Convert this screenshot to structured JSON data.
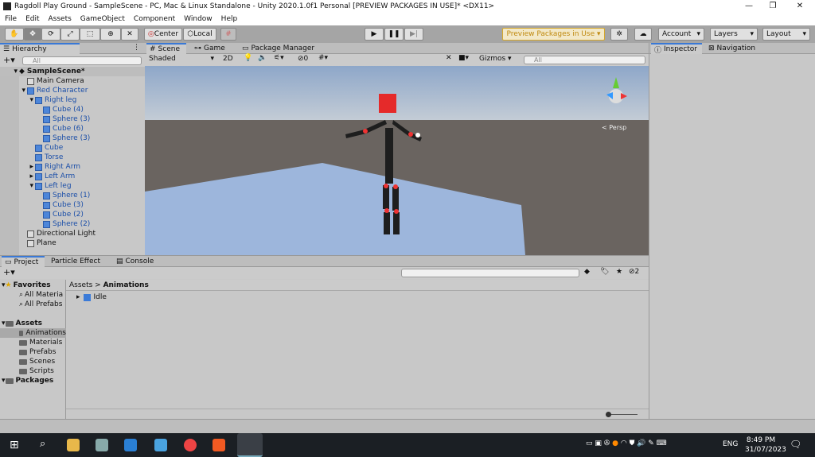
{
  "window": {
    "title": "Ragdoll Play Ground - SampleScene - PC, Mac & Linux Standalone - Unity 2020.1.0f1 Personal [PREVIEW PACKAGES IN USE]* <DX11>",
    "min": "—",
    "max": "❐",
    "close": "✕"
  },
  "menu": [
    "File",
    "Edit",
    "Assets",
    "GameObject",
    "Component",
    "Window",
    "Help"
  ],
  "toolbar": {
    "center": "Center",
    "local": "Local",
    "preview": "Preview Packages in Use ▾",
    "account": "Account",
    "layers": "Layers",
    "layout": "Layout"
  },
  "hierarchy": {
    "title": "Hierarchy",
    "search": "All",
    "items": [
      {
        "label": "SampleScene*",
        "level": 0,
        "arrow": "▾",
        "bold": true
      },
      {
        "label": "Main Camera",
        "level": 1,
        "arrow": ""
      },
      {
        "label": "Red Character",
        "level": 1,
        "arrow": "▾",
        "blue": true
      },
      {
        "label": "Right leg",
        "level": 2,
        "arrow": "▾",
        "blue": true
      },
      {
        "label": "Cube (4)",
        "level": 3,
        "arrow": "",
        "blue": true
      },
      {
        "label": "Sphere (3)",
        "level": 3,
        "arrow": "",
        "blue": true
      },
      {
        "label": "Cube (6)",
        "level": 3,
        "arrow": "",
        "blue": true
      },
      {
        "label": "Sphere (3)",
        "level": 3,
        "arrow": "",
        "blue": true
      },
      {
        "label": "Cube",
        "level": 2,
        "arrow": "",
        "blue": true
      },
      {
        "label": "Torse",
        "level": 2,
        "arrow": "",
        "blue": true
      },
      {
        "label": "Right Arm",
        "level": 2,
        "arrow": "▸",
        "blue": true
      },
      {
        "label": "Left Arm",
        "level": 2,
        "arrow": "▸",
        "blue": true
      },
      {
        "label": "Left leg",
        "level": 2,
        "arrow": "▾",
        "blue": true
      },
      {
        "label": "Sphere (1)",
        "level": 3,
        "arrow": "",
        "blue": true
      },
      {
        "label": "Cube (3)",
        "level": 3,
        "arrow": "",
        "blue": true
      },
      {
        "label": "Cube (2)",
        "level": 3,
        "arrow": "",
        "blue": true
      },
      {
        "label": "Sphere (2)",
        "level": 3,
        "arrow": "",
        "blue": true
      },
      {
        "label": "Directional Light",
        "level": 1,
        "arrow": ""
      },
      {
        "label": "Plane",
        "level": 1,
        "arrow": ""
      }
    ]
  },
  "scene": {
    "tabs": [
      "Scene",
      "Game",
      "Package Manager"
    ],
    "shading": "Shaded",
    "mode2d": "2D",
    "hidden_count": "0",
    "gizmos": "Gizmos",
    "search": "All",
    "persp": "< Persp"
  },
  "inspector": {
    "tabs": [
      "Inspector",
      "Navigation"
    ]
  },
  "project": {
    "tabs": [
      "Project",
      "Particle Effect",
      "Console"
    ],
    "breadcrumb": [
      "Assets",
      "Animations"
    ],
    "hidden_count": "2",
    "tree": [
      {
        "label": "Favorites",
        "level": 0,
        "bold": true,
        "icon": "star"
      },
      {
        "label": "All Materia",
        "level": 1,
        "icon": "search"
      },
      {
        "label": "All Prefabs",
        "level": 1,
        "icon": "search"
      },
      {
        "label": "Assets",
        "level": 0,
        "bold": true,
        "icon": "folder"
      },
      {
        "label": "Animations",
        "level": 1,
        "icon": "folder",
        "selected": true
      },
      {
        "label": "Materials",
        "level": 1,
        "icon": "folder"
      },
      {
        "label": "Prefabs",
        "level": 1,
        "icon": "folder"
      },
      {
        "label": "Scenes",
        "level": 1,
        "icon": "folder"
      },
      {
        "label": "Scripts",
        "level": 1,
        "icon": "folder"
      },
      {
        "label": "Packages",
        "level": 0,
        "bold": true,
        "icon": "folder"
      }
    ],
    "files": [
      "Idle"
    ]
  },
  "taskbar": {
    "lang": "ENG",
    "time": "8:49 PM",
    "date": "31/07/2023"
  }
}
